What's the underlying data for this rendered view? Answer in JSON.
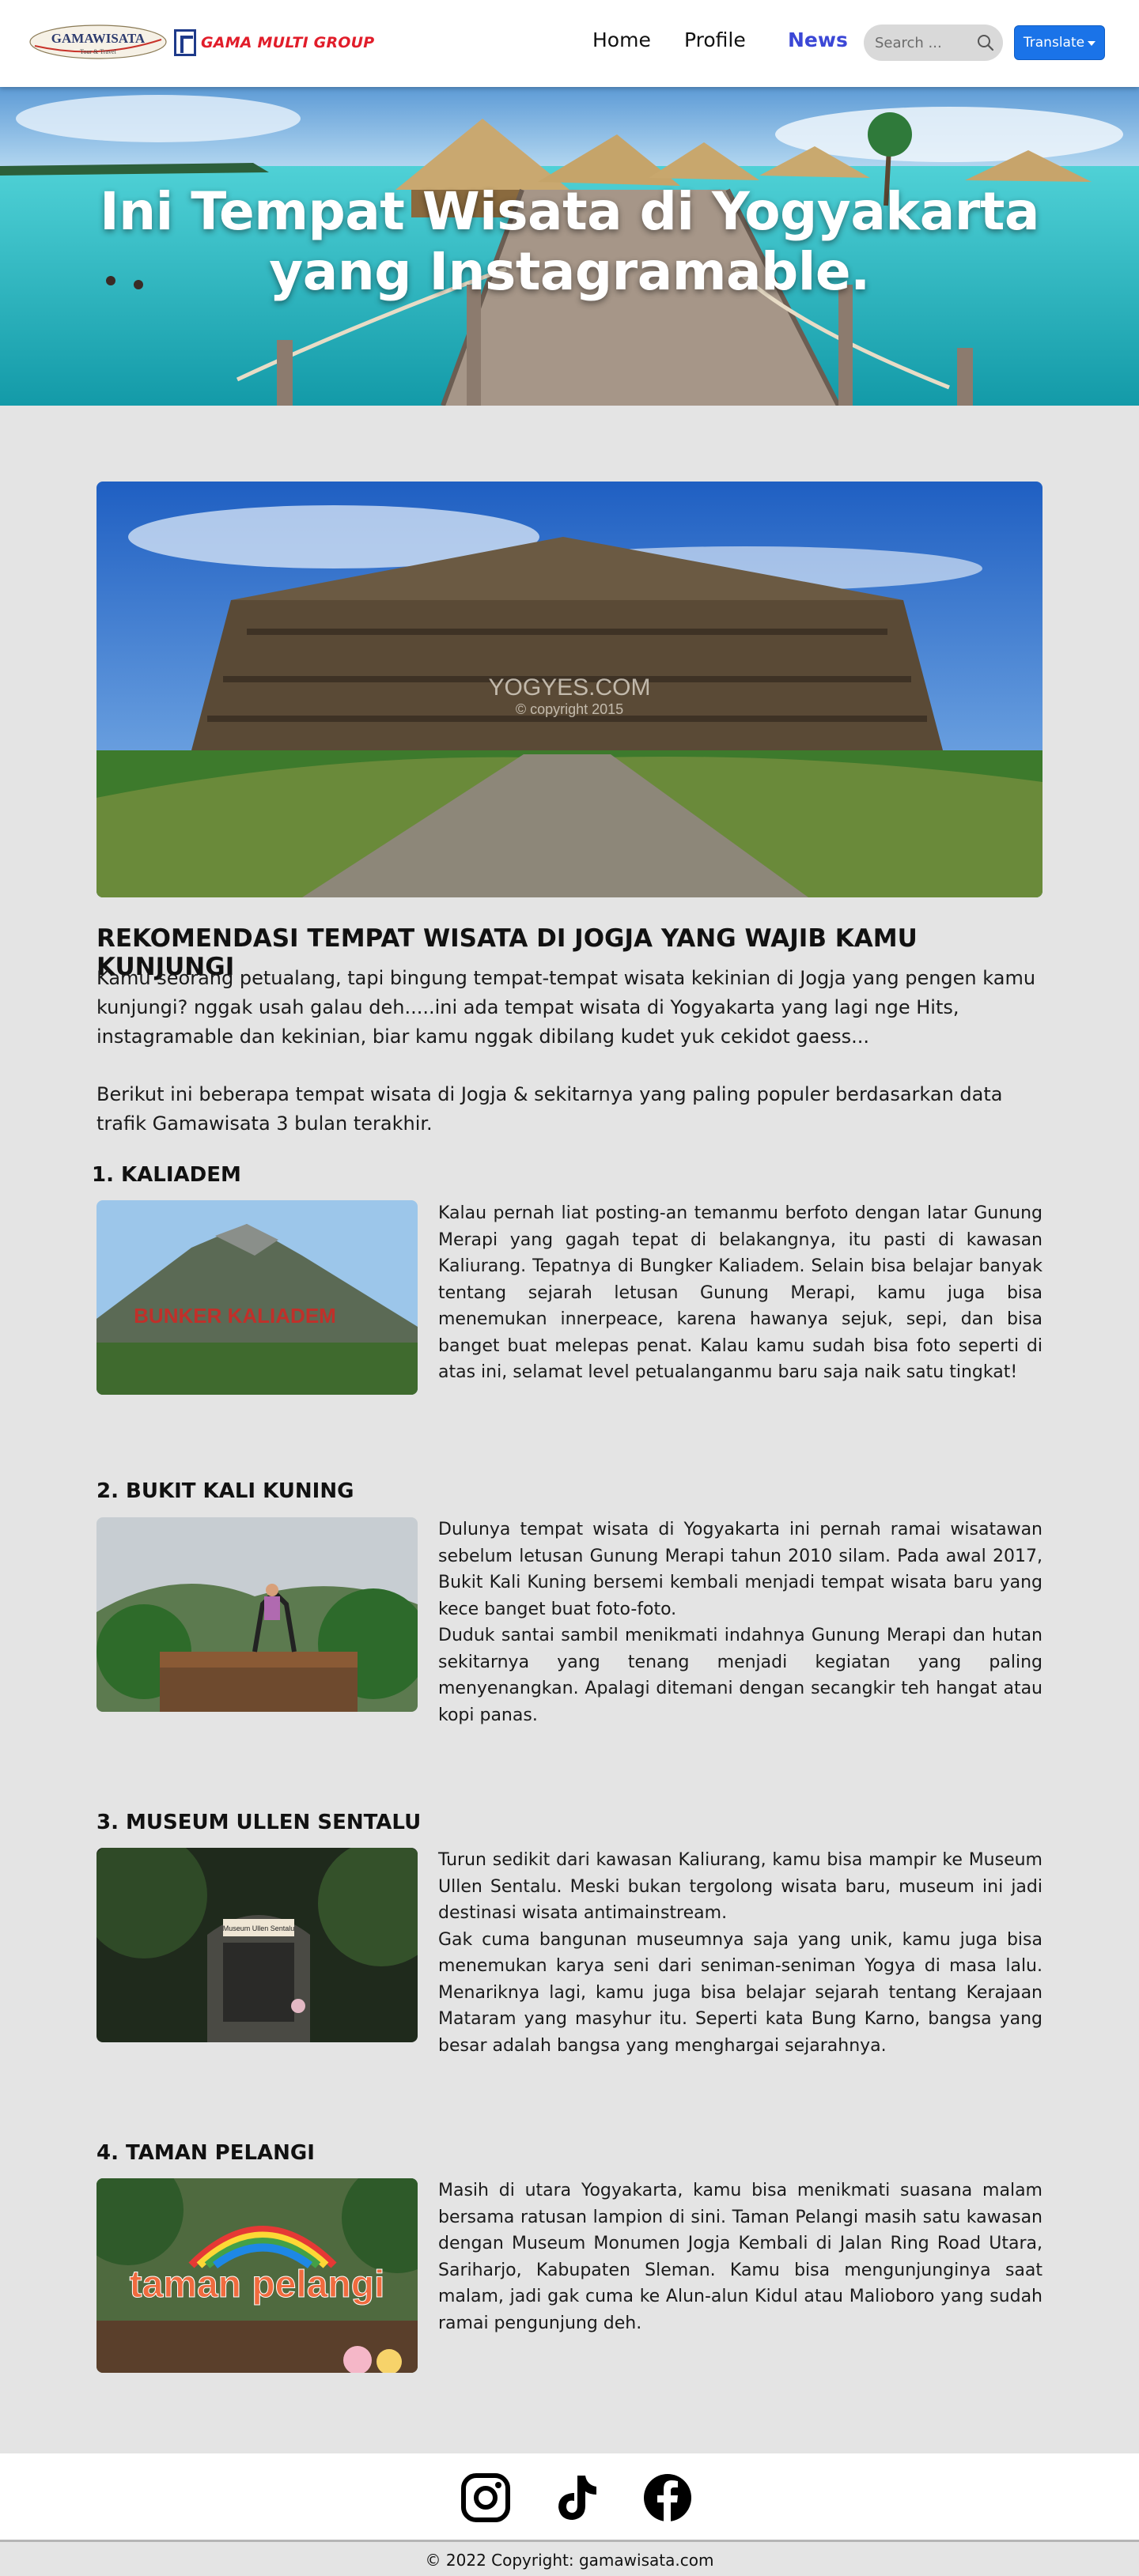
{
  "header": {
    "logo_gamawisata": "GAMAWISATA",
    "logo_gamawisata_tagline": "Tour & Travel",
    "logo_gama_group": "GAMA MULTI GROUP",
    "nav": {
      "home": "Home",
      "profile": "Profile",
      "news": "News"
    },
    "search": {
      "placeholder": "Search ..."
    },
    "translate_label": "Translate"
  },
  "hero": {
    "title": "Ini Tempat Wisata di Yogyakarta yang Instagramable."
  },
  "feature_image": {
    "watermark_line1": "YOGYES.COM",
    "watermark_line2": "© copyright 2015"
  },
  "article": {
    "title": "REKOMENDASI TEMPAT WISATA DI JOGJA YANG WAJIB KAMU KUNJUNGI",
    "intro_p1": "Kamu seorang petualang, tapi bingung tempat-tempat wisata kekinian di Jogja  yang pengen kamu kunjungi? nggak usah galau deh.....ini ada tempat wisata di Yogyakarta yang lagi nge Hits, instagramable dan kekinian, biar kamu nggak dibilang kudet yuk cekidot gaess...",
    "intro_p2": "Berikut ini beberapa tempat wisata di Jogja & sekitarnya yang paling populer berdasarkan data trafik Gamawisata 3 bulan terakhir.",
    "items": [
      {
        "title": "1. KALIADEM",
        "image_label": "BUNKER KALIADEM",
        "paragraphs": [
          "Kalau pernah liat posting-an temanmu berfoto dengan latar Gunung Merapi yang gagah tepat di belakangnya, itu pasti di kawasan Kaliurang. Tepatnya di Bungker Kaliadem. Selain bisa belajar banyak tentang sejarah letusan Gunung Merapi, kamu juga bisa menemukan innerpeace, karena hawanya sejuk, sepi, dan bisa banget buat melepas penat. Kalau kamu sudah bisa foto seperti di atas ini, selamat level petualanganmu baru saja naik satu tingkat!"
        ]
      },
      {
        "title": "2. BUKIT KALI KUNING",
        "paragraphs": [
          "Dulunya tempat wisata di Yogyakarta ini pernah ramai wisatawan sebelum letusan Gunung Merapi tahun 2010 silam. Pada awal 2017, Bukit Kali Kuning bersemi kembali menjadi tempat wisata baru yang kece banget buat foto-foto.",
          " Duduk santai sambil menikmati indahnya Gunung Merapi dan hutan sekitarnya yang tenang menjadi kegiatan yang paling menyenangkan. Apalagi ditemani dengan secangkir teh hangat atau kopi panas."
        ]
      },
      {
        "title": "3. MUSEUM ULLEN SENTALU",
        "image_label": "Museum Ullen Sentalu",
        "paragraphs": [
          "Turun sedikit dari kawasan Kaliurang, kamu bisa mampir ke Museum Ullen Sentalu. Meski bukan tergolong wisata baru, museum ini jadi destinasi wisata antimainstream.",
          " Gak cuma bangunan museumnya saja yang unik, kamu juga bisa menemukan karya seni dari seniman-seniman Yogya di masa lalu. Menariknya lagi, kamu juga bisa belajar sejarah tentang Kerajaan Mataram yang masyhur itu. Seperti kata Bung Karno, bangsa yang besar adalah bangsa yang menghargai sejarahnya."
        ]
      },
      {
        "title": "4. TAMAN PELANGI",
        "image_label": "taman pelangi",
        "paragraphs": [
          "Masih di utara Yogyakarta, kamu bisa menikmati suasana malam bersama ratusan lampion di sini. Taman Pelangi masih satu kawasan dengan Museum Monumen Jogja Kembali di Jalan Ring Road Utara, Sariharjo, Kabupaten Sleman. Kamu bisa mengunjunginya saat malam, jadi gak cuma ke Alun-alun Kidul atau Malioboro yang sudah ramai pengunjung deh."
        ]
      }
    ]
  },
  "footer": {
    "social": [
      "instagram-icon",
      "tiktok-icon",
      "facebook-icon"
    ],
    "copyright": "© 2022 Copyright: gamawisata.com"
  },
  "colors": {
    "page_bg": "#e4e4e4",
    "nav_active": "#3b47d6",
    "translate_bg": "#1a73e8",
    "gama_red": "#e11d2a"
  }
}
